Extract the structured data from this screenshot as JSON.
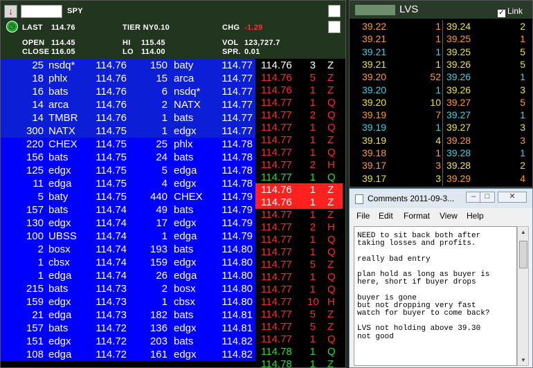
{
  "spy": {
    "symbol": "SPY",
    "last_label": "LAST",
    "last_value": "114.76",
    "tier": "TIER NY0.10",
    "chg_label": "CHG",
    "chg_value": "-1.29",
    "open_label": "OPEN",
    "open_value": "114.45",
    "close_label": "CLOSE",
    "close_value": "116.05",
    "hi_label": "HI",
    "hi_value": "115.45",
    "lo_label": "LO",
    "lo_value": "114.00",
    "vol_label": "VOL",
    "vol_value": "123,727.7",
    "spr_label": "SPR.",
    "spr_value": "0.01",
    "colors": {
      "bid_top": "#0c1ed6",
      "ask_top": "#0c1ed6",
      "book_blue": "#0000ff",
      "tape_highlight": "#ff2020",
      "tape_green": "#22e02a",
      "tape_red": "#ff2a2a"
    },
    "book": [
      {
        "bid_size": "25",
        "bid_ex": "nsdq*",
        "bid_px": "114.76",
        "ask_size": "150",
        "ask_ex": "baty",
        "ask_px": "114.77"
      },
      {
        "bid_size": "18",
        "bid_ex": "phlx",
        "bid_px": "114.76",
        "ask_size": "15",
        "ask_ex": "arca",
        "ask_px": "114.77"
      },
      {
        "bid_size": "16",
        "bid_ex": "bats",
        "bid_px": "114.76",
        "ask_size": "6",
        "ask_ex": "nsdq*",
        "ask_px": "114.77"
      },
      {
        "bid_size": "14",
        "bid_ex": "arca",
        "bid_px": "114.76",
        "ask_size": "2",
        "ask_ex": "NATX",
        "ask_px": "114.77"
      },
      {
        "bid_size": "14",
        "bid_ex": "TMBR",
        "bid_px": "114.76",
        "ask_size": "1",
        "ask_ex": "bats",
        "ask_px": "114.77"
      },
      {
        "bid_size": "300",
        "bid_ex": "NATX",
        "bid_px": "114.75",
        "ask_size": "1",
        "ask_ex": "edgx",
        "ask_px": "114.77"
      },
      {
        "bid_size": "220",
        "bid_ex": "CHEX",
        "bid_px": "114.75",
        "ask_size": "25",
        "ask_ex": "phlx",
        "ask_px": "114.78"
      },
      {
        "bid_size": "156",
        "bid_ex": "bats",
        "bid_px": "114.75",
        "ask_size": "24",
        "ask_ex": "bats",
        "ask_px": "114.78"
      },
      {
        "bid_size": "125",
        "bid_ex": "edgx",
        "bid_px": "114.75",
        "ask_size": "5",
        "ask_ex": "edga",
        "ask_px": "114.78"
      },
      {
        "bid_size": "11",
        "bid_ex": "edga",
        "bid_px": "114.75",
        "ask_size": "4",
        "ask_ex": "edgx",
        "ask_px": "114.78"
      },
      {
        "bid_size": "5",
        "bid_ex": "baty",
        "bid_px": "114.75",
        "ask_size": "440",
        "ask_ex": "CHEX",
        "ask_px": "114.79"
      },
      {
        "bid_size": "157",
        "bid_ex": "bats",
        "bid_px": "114.74",
        "ask_size": "49",
        "ask_ex": "bats",
        "ask_px": "114.79"
      },
      {
        "bid_size": "130",
        "bid_ex": "edgx",
        "bid_px": "114.74",
        "ask_size": "17",
        "ask_ex": "edgx",
        "ask_px": "114.79"
      },
      {
        "bid_size": "100",
        "bid_ex": "UBSS",
        "bid_px": "114.74",
        "ask_size": "1",
        "ask_ex": "edga",
        "ask_px": "114.79"
      },
      {
        "bid_size": "2",
        "bid_ex": "bosx",
        "bid_px": "114.74",
        "ask_size": "193",
        "ask_ex": "bats",
        "ask_px": "114.80"
      },
      {
        "bid_size": "1",
        "bid_ex": "cbsx",
        "bid_px": "114.74",
        "ask_size": "159",
        "ask_ex": "edgx",
        "ask_px": "114.80"
      },
      {
        "bid_size": "1",
        "bid_ex": "edga",
        "bid_px": "114.74",
        "ask_size": "26",
        "ask_ex": "edga",
        "ask_px": "114.80"
      },
      {
        "bid_size": "215",
        "bid_ex": "bats",
        "bid_px": "114.73",
        "ask_size": "2",
        "ask_ex": "bosx",
        "ask_px": "114.80"
      },
      {
        "bid_size": "159",
        "bid_ex": "edgx",
        "bid_px": "114.73",
        "ask_size": "1",
        "ask_ex": "cbsx",
        "ask_px": "114.80"
      },
      {
        "bid_size": "21",
        "bid_ex": "edga",
        "bid_px": "114.73",
        "ask_size": "182",
        "ask_ex": "bats",
        "ask_px": "114.81"
      },
      {
        "bid_size": "157",
        "bid_ex": "bats",
        "bid_px": "114.72",
        "ask_size": "136",
        "ask_ex": "edgx",
        "ask_px": "114.81"
      },
      {
        "bid_size": "151",
        "bid_ex": "edgx",
        "bid_px": "114.72",
        "ask_size": "203",
        "ask_ex": "bats",
        "ask_px": "114.82"
      },
      {
        "bid_size": "108",
        "bid_ex": "edga",
        "bid_px": "114.72",
        "ask_size": "161",
        "ask_ex": "edgx",
        "ask_px": "114.82"
      }
    ],
    "tape": [
      {
        "px": "114.76",
        "size": "3",
        "ex": "Z",
        "style": "white"
      },
      {
        "px": "114.76",
        "size": "5",
        "ex": "Z",
        "style": "red"
      },
      {
        "px": "114.76",
        "size": "1",
        "ex": "Z",
        "style": "red"
      },
      {
        "px": "114.77",
        "size": "1",
        "ex": "Q",
        "style": "red"
      },
      {
        "px": "114.77",
        "size": "2",
        "ex": "Q",
        "style": "red"
      },
      {
        "px": "114.77",
        "size": "1",
        "ex": "Q",
        "style": "red"
      },
      {
        "px": "114.77",
        "size": "1",
        "ex": "Z",
        "style": "red"
      },
      {
        "px": "114.77",
        "size": "1",
        "ex": "Q",
        "style": "red"
      },
      {
        "px": "114.77",
        "size": "2",
        "ex": "H",
        "style": "red"
      },
      {
        "px": "114.77",
        "size": "1",
        "ex": "Q",
        "style": "green"
      },
      {
        "px": "114.76",
        "size": "1",
        "ex": "Z",
        "style": "highlight"
      },
      {
        "px": "114.76",
        "size": "1",
        "ex": "Z",
        "style": "highlight"
      },
      {
        "px": "114.77",
        "size": "1",
        "ex": "Z",
        "style": "red"
      },
      {
        "px": "114.77",
        "size": "2",
        "ex": "H",
        "style": "red"
      },
      {
        "px": "114.77",
        "size": "1",
        "ex": "Q",
        "style": "red"
      },
      {
        "px": "114.77",
        "size": "1",
        "ex": "Q",
        "style": "red"
      },
      {
        "px": "114.77",
        "size": "5",
        "ex": "Z",
        "style": "red"
      },
      {
        "px": "114.77",
        "size": "1",
        "ex": "Q",
        "style": "red"
      },
      {
        "px": "114.77",
        "size": "1",
        "ex": "Q",
        "style": "red"
      },
      {
        "px": "114.77",
        "size": "10",
        "ex": "H",
        "style": "red"
      },
      {
        "px": "114.77",
        "size": "5",
        "ex": "Z",
        "style": "red"
      },
      {
        "px": "114.77",
        "size": "5",
        "ex": "Z",
        "style": "red"
      },
      {
        "px": "114.77",
        "size": "1",
        "ex": "Q",
        "style": "red"
      },
      {
        "px": "114.78",
        "size": "1",
        "ex": "Q",
        "style": "green"
      },
      {
        "px": "114.78",
        "size": "1",
        "ex": "Z",
        "style": "green"
      }
    ]
  },
  "lvs": {
    "symbol": "LVS",
    "link_label": "Link",
    "level_colors": {
      "orange": "#ff9a2a",
      "yellow": "#f0e23a",
      "cyan": "#3ad0e8"
    },
    "rows": [
      {
        "bid_px": "39.22",
        "bid_size": "1",
        "bid_color": "orange",
        "ask_px": "39.24",
        "ask_size": "2",
        "ask_color": "yellow"
      },
      {
        "bid_px": "39.21",
        "bid_size": "1",
        "bid_color": "orange",
        "ask_px": "39.25",
        "ask_size": "1",
        "ask_color": "orange"
      },
      {
        "bid_px": "39.21",
        "bid_size": "1",
        "bid_color": "cyan",
        "ask_px": "39.25",
        "ask_size": "5",
        "ask_color": "yellow"
      },
      {
        "bid_px": "39.21",
        "bid_size": "1",
        "bid_color": "yellow",
        "ask_px": "39.26",
        "ask_size": "5",
        "ask_color": "yellow"
      },
      {
        "bid_px": "39.20",
        "bid_size": "52",
        "bid_color": "orange",
        "ask_px": "39.26",
        "ask_size": "1",
        "ask_color": "cyan"
      },
      {
        "bid_px": "39.20",
        "bid_size": "1",
        "bid_color": "cyan",
        "ask_px": "39.26",
        "ask_size": "3",
        "ask_color": "yellow"
      },
      {
        "bid_px": "39.20",
        "bid_size": "10",
        "bid_color": "yellow",
        "ask_px": "39.27",
        "ask_size": "5",
        "ask_color": "orange"
      },
      {
        "bid_px": "39.19",
        "bid_size": "7",
        "bid_color": "orange",
        "ask_px": "39.27",
        "ask_size": "1",
        "ask_color": "cyan"
      },
      {
        "bid_px": "39.19",
        "bid_size": "1",
        "bid_color": "cyan",
        "ask_px": "39.27",
        "ask_size": "3",
        "ask_color": "yellow"
      },
      {
        "bid_px": "39.19",
        "bid_size": "4",
        "bid_color": "yellow",
        "ask_px": "39.28",
        "ask_size": "3",
        "ask_color": "orange"
      },
      {
        "bid_px": "39.18",
        "bid_size": "1",
        "bid_color": "orange",
        "ask_px": "39.28",
        "ask_size": "1",
        "ask_color": "cyan"
      },
      {
        "bid_px": "39.17",
        "bid_size": "3",
        "bid_color": "orange",
        "ask_px": "39.28",
        "ask_size": "2",
        "ask_color": "yellow"
      },
      {
        "bid_px": "39.17",
        "bid_size": "3",
        "bid_color": "yellow",
        "ask_px": "39.29",
        "ask_size": "4",
        "ask_color": "orange"
      }
    ]
  },
  "notepad": {
    "title": "Comments 2011-09-3...",
    "menu": [
      "File",
      "Edit",
      "Format",
      "View",
      "Help"
    ],
    "lines": [
      "NEED to sit back both after",
      "taking losses and profits.",
      "",
      "really bad entry",
      "",
      "plan hold as long as buyer is",
      "here, short if buyer drops",
      "",
      "buyer is gone",
      "but not dropping very fast",
      "watch for buyer to come back?",
      "",
      "LVS not holding above 39.30",
      "not good"
    ]
  }
}
